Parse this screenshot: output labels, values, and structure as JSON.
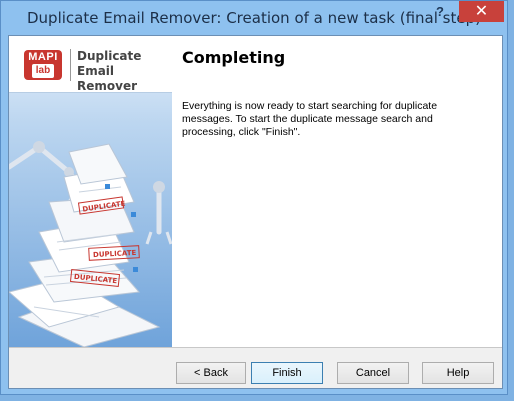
{
  "window": {
    "title": "Duplicate Email Remover: Creation of a new task (final step)",
    "help_glyph": "?",
    "close_glyph": "✕"
  },
  "logo": {
    "mark_top": "MAPI",
    "mark_bottom": "lab",
    "product_line1": "Duplicate",
    "product_line2": "Email Remover"
  },
  "illustration": {
    "stamp1": "DUPLICATE",
    "stamp2": "DUPLICATE",
    "stamp3": "DUPLICATE"
  },
  "page": {
    "heading": "Completing",
    "description": "Everything is now ready to start searching for duplicate messages.  To start the duplicate message search and processing, click \"Finish\"."
  },
  "buttons": {
    "back": "< Back",
    "finish": "Finish",
    "cancel": "Cancel",
    "help": "Help"
  },
  "colors": {
    "close_button": "#c8413b",
    "title_bar": "#8ec1ef",
    "logo_red": "#c8362f"
  }
}
